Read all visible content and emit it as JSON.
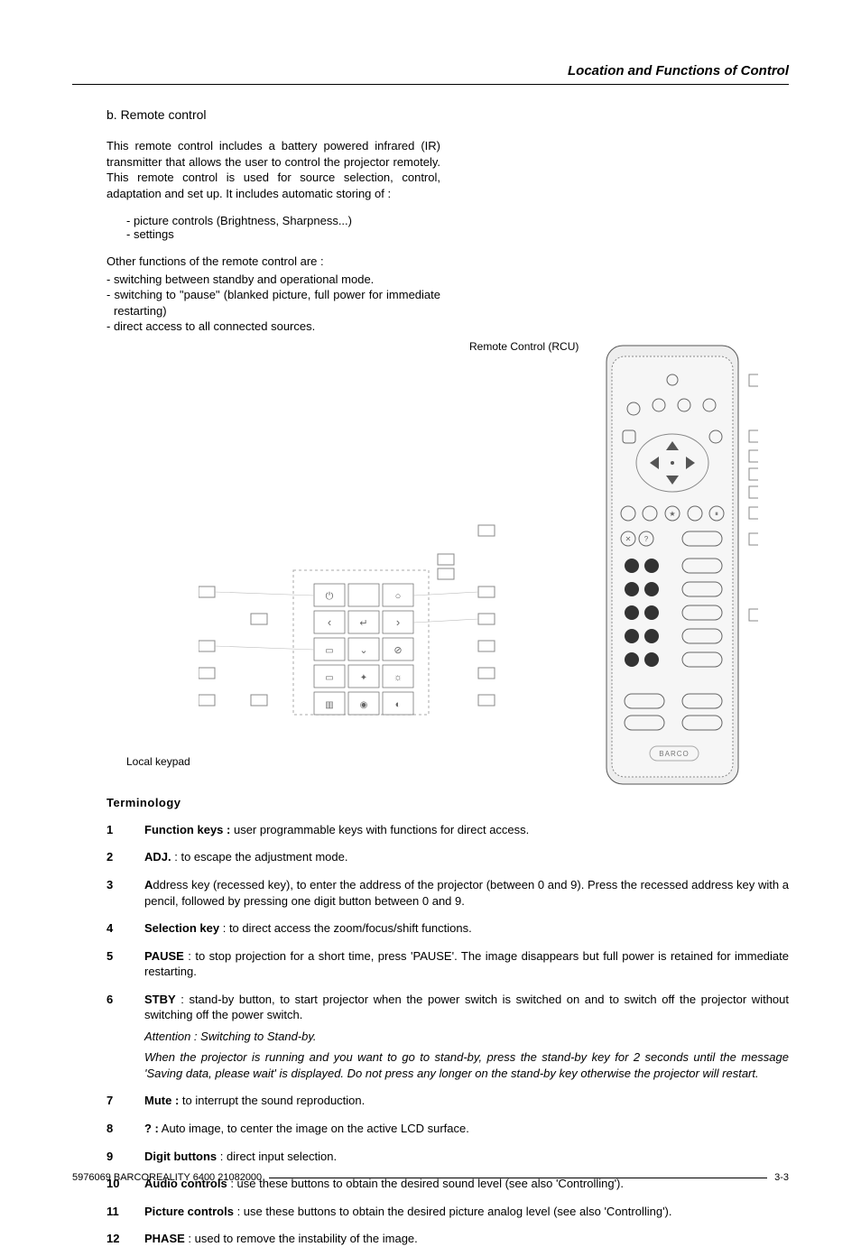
{
  "header": {
    "title": "Location and Functions of Control"
  },
  "section": {
    "heading": "b. Remote control",
    "intro": "This remote control includes a battery powered infrared (IR) transmitter that allows the user to control the projector remotely. This remote control is used for source selection, control, adaptation and set up.  It includes automatic storing of :",
    "intro_bullets": [
      "- picture controls (Brightness, Sharpness...)",
      "- settings"
    ],
    "other_intro": "Other functions of the remote control are :",
    "other_items": [
      "- switching between standby and operational mode.",
      "- switching to \"pause\" (blanked picture, full power for immediate restarting)",
      "- direct access to all connected sources."
    ],
    "rcu_caption": "Remote Control (RCU)",
    "keypad_caption": "Local keypad",
    "brand": "BARCO"
  },
  "terminology": {
    "title": "Terminology",
    "items": [
      {
        "n": "1",
        "label": "Function keys :",
        "text": " user programmable keys with functions for direct access."
      },
      {
        "n": "2",
        "label": "ADJ.",
        "text": " : to escape the adjustment mode."
      },
      {
        "n": "3",
        "label": "A",
        "text": "ddress key (recessed key), to enter the address of the projector (between 0 and 9).  Press the recessed address key with a pencil, followed by pressing one digit button between 0 and 9."
      },
      {
        "n": "4",
        "label": "Selection key",
        "text": " : to direct access the zoom/focus/shift functions."
      },
      {
        "n": "5",
        "label": "PAUSE",
        "text": " : to stop projection for a short time, press 'PAUSE'.  The image disappears but full power is retained for immediate restarting."
      },
      {
        "n": "6",
        "label": "STBY",
        "text": " : stand-by button, to start projector when the power switch is switched on and to switch off the projector without switching off the power switch.",
        "attention": "Attention : Switching to Stand-by.",
        "attention_body": "When the projector is running and you want to go to stand-by, press the stand-by key for 2 seconds until the message 'Saving data, please wait' is displayed.  Do not press any longer on the stand-by key otherwise the projector will restart."
      },
      {
        "n": "7",
        "label": "Mute :",
        "text": " to interrupt the sound reproduction."
      },
      {
        "n": "8",
        "label": "? :",
        "text": " Auto image, to center the image on the active LCD surface."
      },
      {
        "n": "9",
        "label": "Digit buttons",
        "text": " : direct input selection."
      },
      {
        "n": "10",
        "label": "Audio controls",
        "text": " : use these buttons to obtain the desired sound level (see also 'Controlling')."
      },
      {
        "n": "11",
        "label": "Picture controls",
        "text": " : use these buttons to obtain the desired picture analog level (see also 'Controlling')."
      },
      {
        "n": "12",
        "label": "PHASE",
        "text": " : used to remove the instability of the image."
      }
    ]
  },
  "footer": {
    "left": "5976069 BARCOREALITY 6400 21082000",
    "right": "3-3"
  }
}
